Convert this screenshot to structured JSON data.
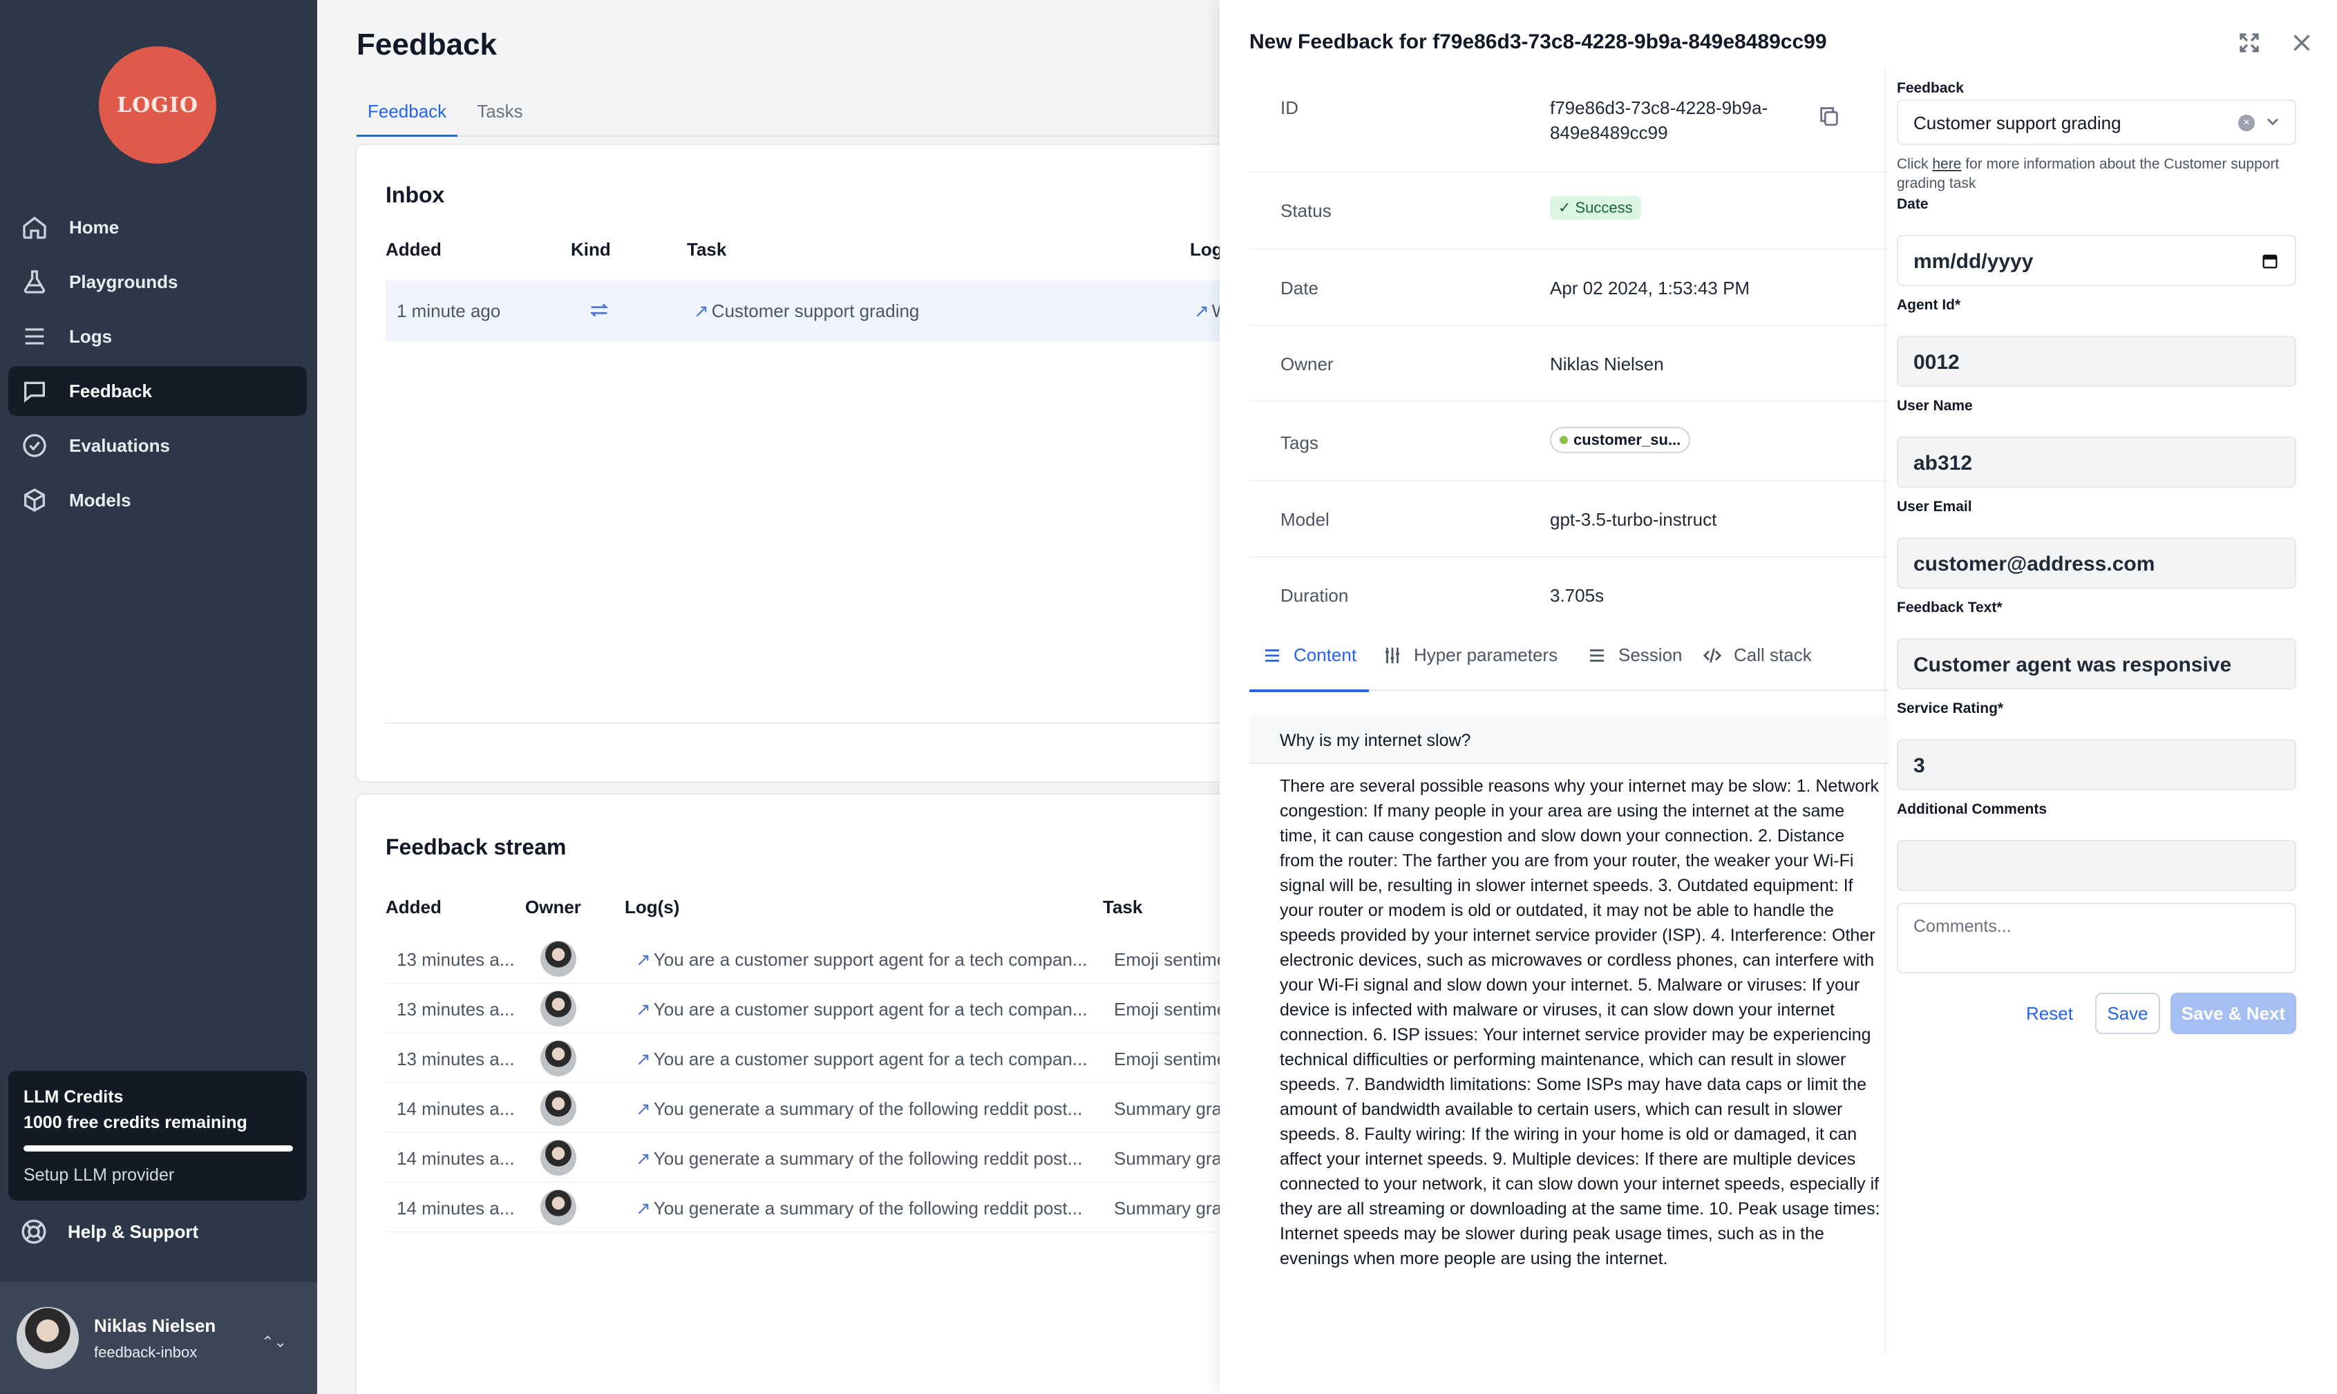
{
  "sidebar": {
    "logo_text": "LOGIO",
    "items": [
      {
        "label": "Home",
        "icon": "home-icon"
      },
      {
        "label": "Playgrounds",
        "icon": "flask-icon"
      },
      {
        "label": "Logs",
        "icon": "list-icon"
      },
      {
        "label": "Feedback",
        "icon": "chat-bubble-icon"
      },
      {
        "label": "Evaluations",
        "icon": "check-circle-icon"
      },
      {
        "label": "Models",
        "icon": "cube-icon"
      }
    ],
    "credits": {
      "title": "LLM Credits",
      "subtitle": "1000 free credits remaining",
      "progress": 1.0,
      "setup": "Setup LLM provider"
    },
    "help": "Help & Support",
    "user": {
      "name": "Niklas Nielsen",
      "project": "feedback-inbox"
    }
  },
  "main": {
    "title": "Feedback",
    "tabs": [
      "Feedback",
      "Tasks"
    ],
    "inbox": {
      "title": "Inbox",
      "columns": [
        "Added",
        "Kind",
        "Task",
        "Log"
      ],
      "rows": [
        {
          "added": "1 minute ago",
          "kind_icon": "swap-arrows-icon",
          "task": "Customer support grading",
          "log": "Why"
        }
      ]
    },
    "stream": {
      "title": "Feedback stream",
      "columns": [
        "Added",
        "Owner",
        "Log(s)",
        "Task"
      ],
      "rows": [
        {
          "added": "13 minutes a...",
          "log": "You are a customer support agent for a tech compan...",
          "task": "Emoji sentime"
        },
        {
          "added": "13 minutes a...",
          "log": "You are a customer support agent for a tech compan...",
          "task": "Emoji sentime"
        },
        {
          "added": "13 minutes a...",
          "log": "You are a customer support agent for a tech compan...",
          "task": "Emoji sentime"
        },
        {
          "added": "14 minutes a...",
          "log": "You generate a summary of the following reddit post...",
          "task": "Summary gra"
        },
        {
          "added": "14 minutes a...",
          "log": "You generate a summary of the following reddit post...",
          "task": "Summary gra"
        },
        {
          "added": "14 minutes a...",
          "log": "You generate a summary of the following reddit post...",
          "task": "Summary gra"
        }
      ]
    }
  },
  "drawer": {
    "title": "New Feedback for f79e86d3-73c8-4228-9b9a-849e8489cc99",
    "details": {
      "id_label": "ID",
      "id_line1": "f79e86d3-73c8-4228-9b9a-",
      "id_line2": "849e8489cc99",
      "status_label": "Status",
      "status": "Success",
      "date_label": "Date",
      "date": "Apr 02 2024, 1:53:43 PM",
      "owner_label": "Owner",
      "owner": "Niklas Nielsen",
      "tags_label": "Tags",
      "tag": "customer_su...",
      "model_label": "Model",
      "model": "gpt-3.5-turbo-instruct",
      "duration_label": "Duration",
      "duration": "3.705s"
    },
    "content_tabs": [
      "Content",
      "Hyper parameters",
      "Session",
      "Call stack"
    ],
    "question": "Why is my internet slow?",
    "answer": "There are several possible reasons why your internet may be slow: 1. Network congestion: If many people in your area are using the internet at the same time, it can cause congestion and slow down your connection. 2. Distance from the router: The farther you are from your router, the weaker your Wi-Fi signal will be, resulting in slower internet speeds. 3. Outdated equipment: If your router or modem is old or outdated, it may not be able to handle the speeds provided by your internet service provider (ISP). 4. Interference: Other electronic devices, such as microwaves or cordless phones, can interfere with your Wi-Fi signal and slow down your internet. 5. Malware or viruses: If your device is infected with malware or viruses, it can slow down your internet connection. 6. ISP issues: Your internet service provider may be experiencing technical difficulties or performing maintenance, which can result in slower speeds. 7. Bandwidth limitations: Some ISPs may have data caps or limit the amount of bandwidth available to certain users, which can result in slower speeds. 8. Faulty wiring: If the wiring in your home is old or damaged, it can affect your internet speeds. 9. Multiple devices: If there are multiple devices connected to your network, it can slow down your internet speeds, especially if they are all streaming or downloading at the same time. 10. Peak usage times: Internet speeds may be slower during peak usage times, such as in the evenings when more people are using the internet.",
    "form": {
      "feedback_label": "Feedback",
      "feedback_value": "Customer support grading",
      "help_prefix": "Click ",
      "help_link": "here",
      "help_suffix": " for more information about the Customer support grading task",
      "date_label": "Date",
      "date_placeholder": "mm/dd/yyyy",
      "agent_label": "Agent Id*",
      "agent_value": "0012",
      "username_label": "User Name",
      "username_value": "ab312",
      "email_label": "User Email",
      "email_value": "customer@address.com",
      "text_label": "Feedback Text*",
      "text_value": "Customer agent was responsive",
      "rating_label": "Service Rating*",
      "rating_value": "3",
      "comments_label": "Additional Comments",
      "comments_value": "",
      "comments_placeholder": "Comments...",
      "reset": "Reset",
      "save": "Save",
      "save_next": "Save & Next"
    }
  }
}
